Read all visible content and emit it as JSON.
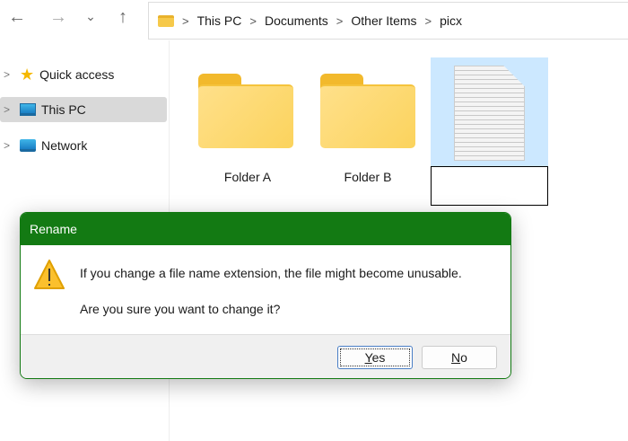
{
  "toolbar": {
    "back_icon": "←",
    "forward_icon": "→",
    "recent_icon": "⌄",
    "up_icon": "↑"
  },
  "breadcrumb": [
    "This PC",
    "Documents",
    "Other Items",
    "picx"
  ],
  "sidebar": {
    "items": [
      {
        "label": "Quick access",
        "icon": "star-icon"
      },
      {
        "label": "This PC",
        "icon": "monitor-icon"
      },
      {
        "label": "Network",
        "icon": "network-icon"
      }
    ]
  },
  "files": [
    {
      "name": "Folder A",
      "type": "folder"
    },
    {
      "name": "Folder B",
      "type": "folder"
    },
    {
      "name": "",
      "type": "file",
      "renaming": true
    }
  ],
  "dialog": {
    "title": "Rename",
    "message": "If you change a file name extension, the file might become unusable.",
    "question": "Are you sure you want to change it?",
    "yes_label": "Yes",
    "yes_accel": "Y",
    "yes_rest": "es",
    "no_label": "No",
    "no_accel": "N",
    "no_rest": "o"
  },
  "colors": {
    "dialog_header": "#137a13",
    "selection": "#cce8ff"
  }
}
